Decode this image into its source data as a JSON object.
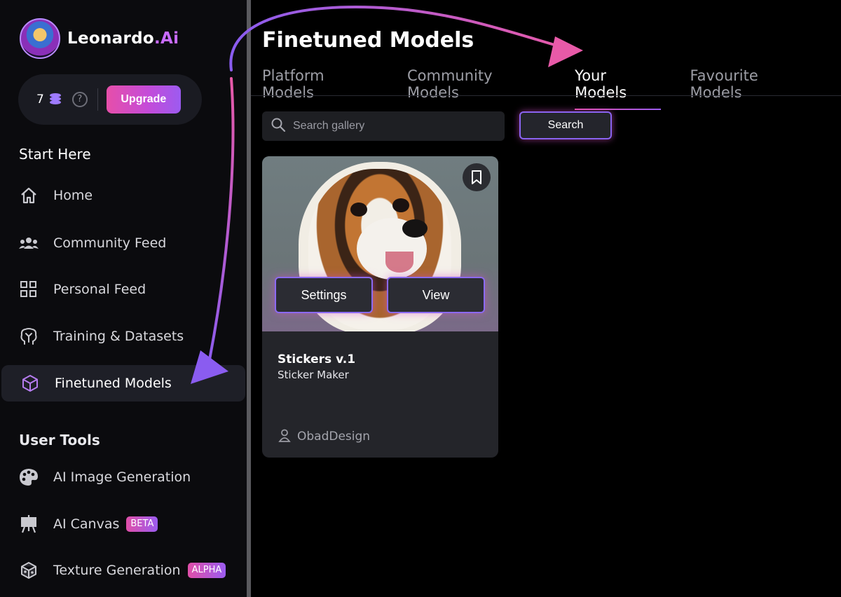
{
  "brand": {
    "name": "Leonardo",
    "suffix": ".Ai"
  },
  "credits": {
    "count": "7",
    "help": "?",
    "upgrade_label": "Upgrade"
  },
  "sections": {
    "start": "Start Here",
    "tools": "User Tools"
  },
  "nav": [
    {
      "label": "Home",
      "icon": "home-icon"
    },
    {
      "label": "Community Feed",
      "icon": "people-icon"
    },
    {
      "label": "Personal Feed",
      "icon": "grid-icon"
    },
    {
      "label": "Training & Datasets",
      "icon": "brain-icon"
    },
    {
      "label": "Finetuned Models",
      "icon": "cube-icon",
      "active": true
    }
  ],
  "tools": [
    {
      "label": "AI Image Generation",
      "icon": "palette-icon"
    },
    {
      "label": "AI Canvas",
      "icon": "easel-icon",
      "badge": "BETA"
    },
    {
      "label": "Texture Generation",
      "icon": "texture-cube-icon",
      "badge": "ALPHA"
    }
  ],
  "main": {
    "title": "Finetuned Models",
    "tabs": [
      "Platform Models",
      "Community Models",
      "Your Models",
      "Favourite Models"
    ],
    "active_tab": "Your Models",
    "search_placeholder": "Search gallery",
    "search_button": "Search"
  },
  "card": {
    "title": "Stickers v.1",
    "subtitle": "Sticker Maker",
    "author": "ObadDesign",
    "settings_label": "Settings",
    "view_label": "View"
  },
  "colors": {
    "accent_pink": "#e64fa9",
    "accent_purple": "#9c5bf0",
    "brand_ai": "#c86bff"
  }
}
